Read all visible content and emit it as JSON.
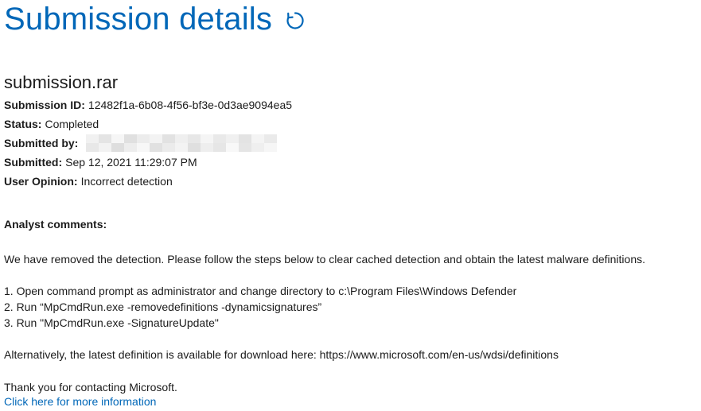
{
  "header": {
    "title": "Submission details",
    "refresh_icon": "refresh-icon"
  },
  "submission": {
    "file_name": "submission.rar",
    "id_label": "Submission ID:",
    "id_value": "12482f1a-6b08-4f56-bf3e-0d3ae9094ea5",
    "status_label": "Status:",
    "status_value": "Completed",
    "submitted_by_label": "Submitted by:",
    "submitted_label": "Submitted:",
    "submitted_value": "Sep 12, 2021 11:29:07 PM",
    "opinion_label": "User Opinion:",
    "opinion_value": "Incorrect detection"
  },
  "analyst": {
    "heading": "Analyst comments:",
    "intro": "We have removed the detection. Please follow the steps below to clear cached detection and obtain the latest malware definitions.",
    "step1": "1. Open command prompt as administrator and change directory to c:\\Program Files\\Windows Defender",
    "step2": "2. Run “MpCmdRun.exe -removedefinitions -dynamicsignatures”",
    "step3": "3. Run \"MpCmdRun.exe -SignatureUpdate\"",
    "alternative": "Alternatively, the latest definition is available for download here: https://www.microsoft.com/en-us/wdsi/definitions",
    "thanks": "Thank you for contacting Microsoft."
  },
  "links": {
    "more_info": "Click here for more information"
  },
  "colors": {
    "accent": "#0067b8",
    "text": "#1b1b1b"
  }
}
